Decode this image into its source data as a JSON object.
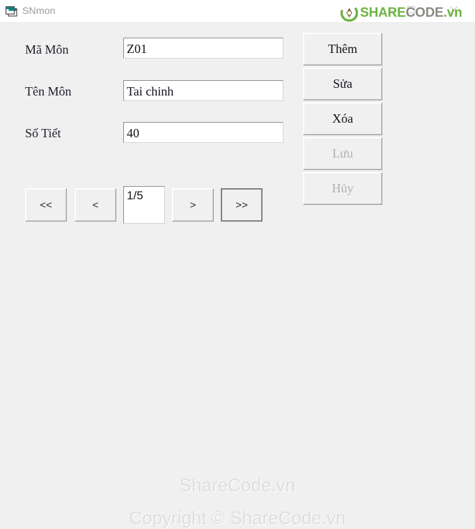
{
  "window": {
    "title": "SNmon",
    "icon": "form-window-icon",
    "controls": {
      "minimize": "minimize-icon",
      "maximize": "maximize-icon",
      "close": "close-icon"
    }
  },
  "branding": {
    "logo_icon": "sharecode-recycle-logo-icon",
    "word_part1": "SHARE",
    "word_part2": "CODE",
    "word_part3": ".vn",
    "green": "#6cb33f",
    "gray": "#8a8a82"
  },
  "form": {
    "fields": [
      {
        "label": "Mã Môn",
        "value": "Z01"
      },
      {
        "label": "Tên Môn",
        "value": "Tai chinh"
      },
      {
        "label": "Số Tiết",
        "value": "40"
      }
    ],
    "navigation": {
      "first": "<<",
      "prev": "<",
      "position": "1/5",
      "next": ">",
      "last": ">>"
    },
    "actions": [
      {
        "label": "Thêm",
        "enabled": true
      },
      {
        "label": "Sửa",
        "enabled": true
      },
      {
        "label": "Xóa",
        "enabled": true
      },
      {
        "label": "Lưu",
        "enabled": false
      },
      {
        "label": "Hủy",
        "enabled": false
      }
    ]
  },
  "footer": {
    "line1": "ShareCode.vn",
    "line2": "Copyright © ShareCode.vn"
  }
}
